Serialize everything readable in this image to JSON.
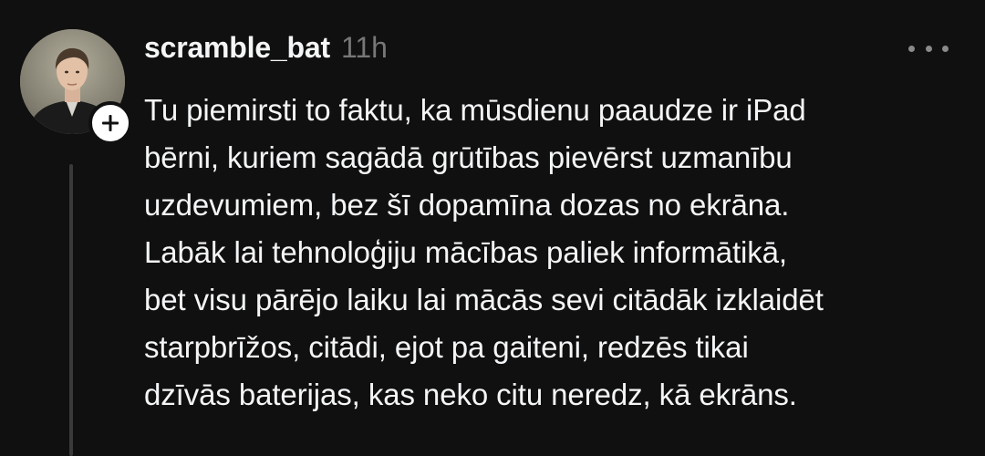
{
  "post": {
    "username": "scramble_bat",
    "timestamp": "11h",
    "follow_icon": "plus-icon",
    "more_icon": "more-horizontal-icon",
    "text_lines": [
      "Tu piemirsti to faktu, ka mūsdienu paaudze ir iPad",
      "bērni, kuriem sagādā grūtības pievērst uzmanību",
      "uzdevumiem, bez šī dopamīna dozas no ekrāna.",
      "Labāk lai tehnoloģiju mācības paliek informātikā,",
      "bet visu pārējo laiku lai mācās sevi citādāk izklaidēt",
      "starpbrīžos, citādi, ejot pa gaiteni, redzēs tikai",
      "dzīvās baterijas, kas neko citu neredz, kā ekrāns."
    ]
  },
  "colors": {
    "background": "#101010",
    "primary_text": "#f3f5f7",
    "secondary_text": "#777777",
    "thread_line": "#3a3a3a"
  }
}
